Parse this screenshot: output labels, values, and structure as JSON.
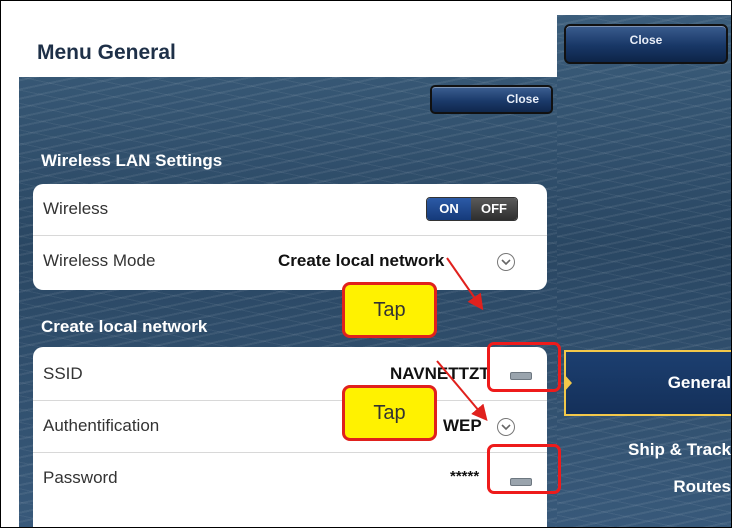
{
  "header": {
    "title": "Menu General"
  },
  "buttons": {
    "close_left": "Close",
    "close_right": "Close"
  },
  "wireless_section": {
    "title": "Wireless LAN Settings",
    "wireless": {
      "label": "Wireless",
      "on": "ON",
      "off": "OFF"
    },
    "mode": {
      "label": "Wireless Mode",
      "value": "Create local network"
    }
  },
  "local_network": {
    "title": "Create local network",
    "ssid": {
      "label": "SSID",
      "value": "NAVNETTZT"
    },
    "auth": {
      "label": "Authentification",
      "value": "WEP"
    },
    "password": {
      "label": "Password",
      "value": "*****"
    }
  },
  "nav": {
    "general": "General",
    "ship": "Ship & Track",
    "routes": "Routes"
  },
  "annotations": {
    "tap1": "Tap",
    "tap2": "Tap"
  },
  "colors": {
    "annotation_fill": "#fff200",
    "annotation_border": "#e0211d",
    "accent": "#f3c84a"
  }
}
